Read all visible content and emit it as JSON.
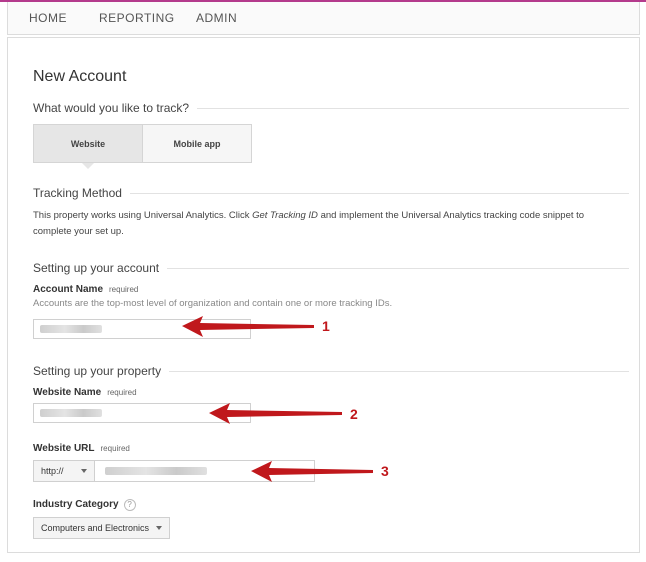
{
  "nav": {
    "home": "HOME",
    "reporting": "REPORTING",
    "admin": "ADMIN"
  },
  "page": {
    "title": "New Account",
    "track_question": "What would you like to track?",
    "track_options": [
      "Website",
      "Mobile app"
    ],
    "tracking_method_heading": "Tracking Method",
    "tracking_text_before": "This property works using Universal Analytics. Click ",
    "tracking_text_italic": "Get Tracking ID",
    "tracking_text_after": " and implement the Universal Analytics tracking code snippet to complete your set up.",
    "account_section": "Setting up your account",
    "account_name_label": "Account Name",
    "required_label": "required",
    "account_hint": "Accounts are the top-most level of organization and contain one or more tracking IDs.",
    "property_section": "Setting up your property",
    "website_name_label": "Website Name",
    "website_url_label": "Website URL",
    "protocol_value": "http://",
    "industry_label": "Industry Category",
    "help_glyph": "?",
    "industry_value": "Computers and Electronics"
  },
  "annotations": [
    "1",
    "2",
    "3"
  ],
  "colors": {
    "accent": "#b43a8c",
    "arrow": "#c0181c"
  }
}
